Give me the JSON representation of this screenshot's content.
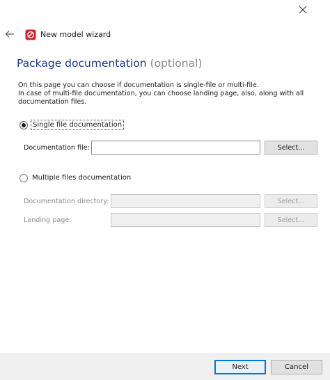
{
  "window": {
    "title": "New model wizard",
    "close_icon": "close-icon",
    "back_icon": "back-arrow-icon",
    "app_icon": "app-logo-icon"
  },
  "page": {
    "heading": "Package documentation",
    "heading_optional": "(optional)",
    "description_lines": [
      "On this page you can choose if documentation is single-file or multi-file.",
      "In case of multi-file documentation, you can choose landing page, also, along with all",
      "documentation files."
    ]
  },
  "single": {
    "radio_label": "Single file documentation",
    "selected": true,
    "file_label": "Documentation file:",
    "file_value": "",
    "select_label": "Select..."
  },
  "multiple": {
    "radio_label": "Multiple files documentation",
    "selected": false,
    "dir_label": "Documentation directory:",
    "dir_value": "",
    "dir_select_label": "Select...",
    "landing_label": "Landing page:",
    "landing_value": "",
    "landing_select_label": "Select..."
  },
  "footer": {
    "next_label": "Next",
    "cancel_label": "Cancel"
  },
  "colors": {
    "heading": "#1b3a8c",
    "optional": "#8a8a8a",
    "accent": "#0078d7",
    "app_icon": "#d6202c"
  }
}
